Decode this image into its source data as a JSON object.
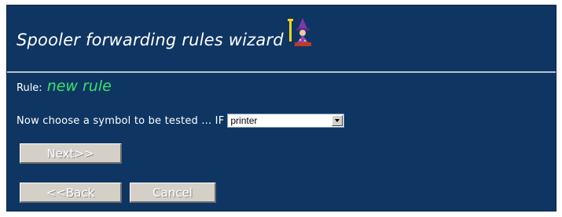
{
  "wizard": {
    "title": "Spooler forwarding rules wizard",
    "icon": "wizard-icon"
  },
  "rule": {
    "label": "Rule:",
    "name": "new rule"
  },
  "prompt": {
    "text": "Now choose a symbol to be tested ... IF",
    "select": {
      "selected": "printer"
    }
  },
  "buttons": {
    "next": "Next>>",
    "back": "<<Back",
    "cancel": "Cancel"
  },
  "colors": {
    "background": "#0f3563",
    "rule_name": "#33e56b",
    "button_face": "#d4d0c8"
  }
}
